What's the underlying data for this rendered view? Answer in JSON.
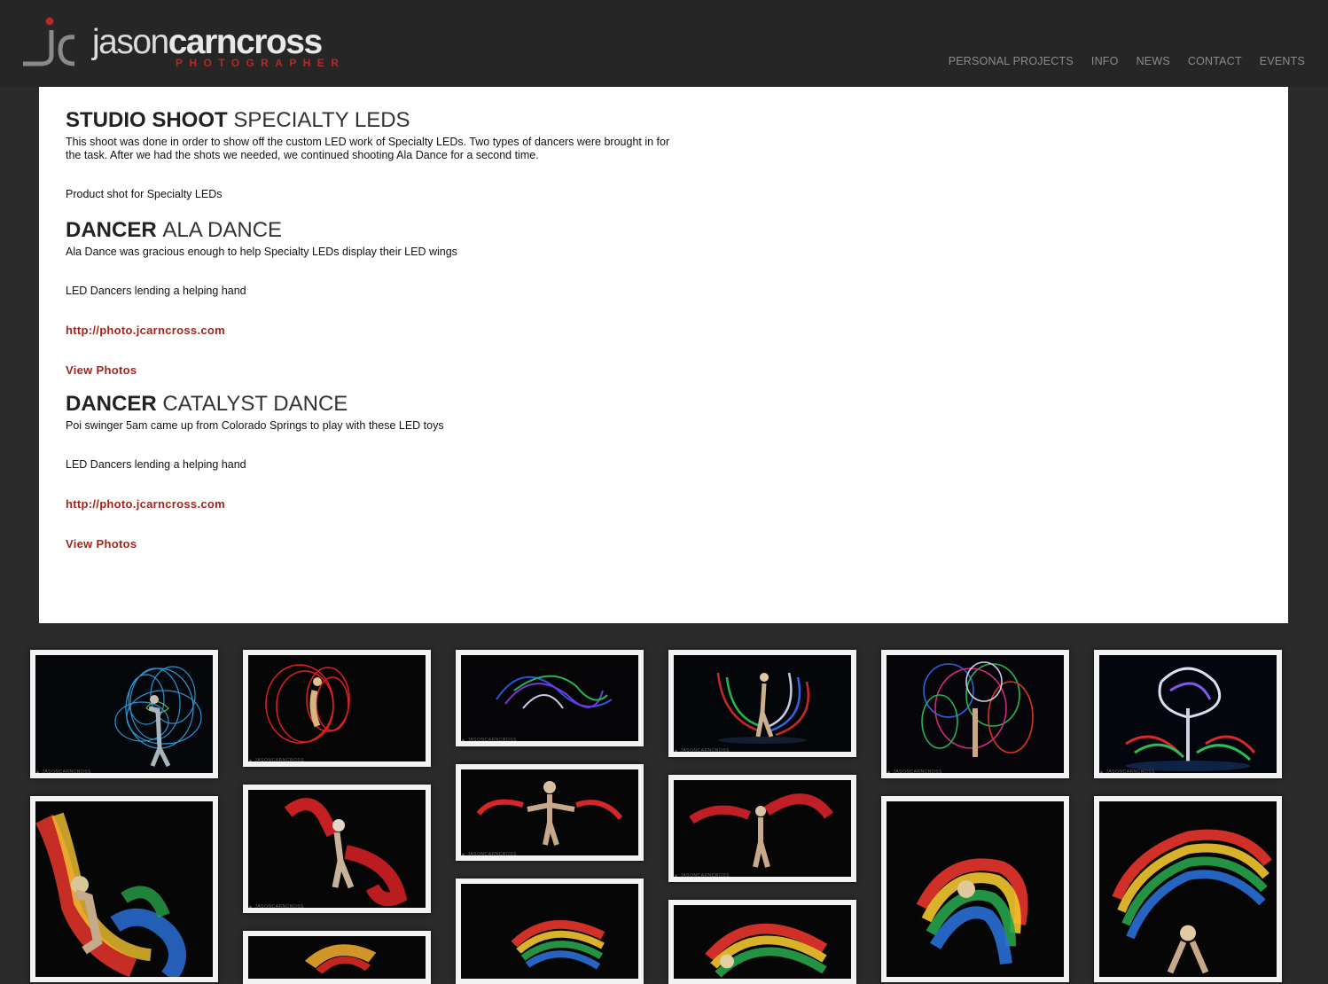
{
  "site": {
    "logo_light": "jason",
    "logo_bold": "carncross",
    "logo_sub": "PHOTOGRAPHER"
  },
  "nav": [
    {
      "label": "PERSONAL PROJECTS"
    },
    {
      "label": "INFO"
    },
    {
      "label": "NEWS"
    },
    {
      "label": "CONTACT"
    },
    {
      "label": "EVENTS"
    }
  ],
  "sections": [
    {
      "title_bold": "STUDIO SHOOT",
      "title_rest": "SPECIALTY LEDS",
      "description": "This shoot was done in order to show off the custom LED work of Specialty LEDs. Two types of dancers were brought in for the task. After we had the shots we needed, we continued shooting Ala Dance for a second time.",
      "caption": "Product shot for Specialty LEDs"
    },
    {
      "title_bold": "DANCER",
      "title_rest": "ALA DANCE",
      "description": "Ala Dance was gracious enough to help Specialty LEDs display their LED wings",
      "caption": "LED Dancers lending a helping hand",
      "link": "http://photo.jcarncross.com",
      "view": "View Photos"
    },
    {
      "title_bold": "DANCER",
      "title_rest": "CATALYST DANCE",
      "description": "Poi swinger 5am came up from Colorado Springs to play with these LED toys",
      "caption": "LED Dancers lending a helping hand",
      "link": "http://photo.jcarncross.com",
      "view": "View Photos"
    }
  ],
  "colors": {
    "accent": "#a3251e",
    "page_bg": "#2b2b2b",
    "header_bg": "#262626",
    "content_bg": "#ffffff"
  }
}
